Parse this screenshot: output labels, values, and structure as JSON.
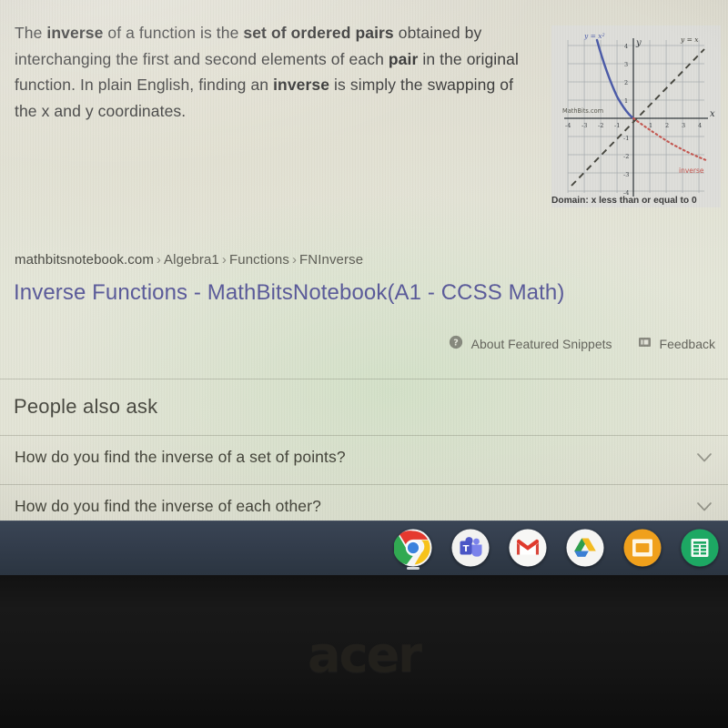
{
  "snippet": {
    "paragraph_runs": [
      {
        "text": "The ",
        "bold": false
      },
      {
        "text": "inverse",
        "bold": true
      },
      {
        "text": " of a function is the ",
        "bold": false
      },
      {
        "text": "set of ordered pairs",
        "bold": true
      },
      {
        "text": " obtained by interchanging the first and second elements of each ",
        "bold": false
      },
      {
        "text": "pair",
        "bold": true
      },
      {
        "text": " in the original function. In plain English, finding an ",
        "bold": false
      },
      {
        "text": "inverse",
        "bold": true
      },
      {
        "text": " is simply the swapping of the x and y coordinates.",
        "bold": false
      }
    ],
    "domain_caption": "Domain:  x less than or equal to 0"
  },
  "figure": {
    "watermark": "MathBits.com",
    "label_parabola": "y = x",
    "label_parabola_exponent": "2",
    "label_identity": "y = x",
    "label_inverse": "inverse",
    "axis_label_x": "x",
    "axis_label_y": "y",
    "x_ticks": [
      "-4",
      "-3",
      "-2",
      "-1",
      "1",
      "2",
      "3",
      "4"
    ],
    "y_ticks": [
      "4",
      "3",
      "2",
      "1",
      "-1",
      "-2",
      "-3",
      "-4"
    ],
    "colors": {
      "parabola": "#4a5aa8",
      "inverse": "#c4564f",
      "identity": "#4a4a42",
      "grid": "#9aa0a8",
      "axis": "#33383c"
    }
  },
  "result": {
    "breadcrumb_host": "mathbitsnotebook.com",
    "breadcrumb_separator": "›",
    "breadcrumb_path": [
      "Algebra1",
      "Functions",
      "FNInverse"
    ],
    "title": "Inverse Functions - MathBitsNotebook(A1 - CCSS Math)",
    "title_color": "#5a5a9a"
  },
  "snippet_footer": {
    "about_label": "About Featured Snippets",
    "about_icon": "question-circle-icon",
    "feedback_label": "Feedback",
    "feedback_icon": "feedback-flag-icon"
  },
  "people_also_ask": {
    "heading": "People also ask",
    "questions": [
      {
        "text": "How do you find the inverse of a set of points?",
        "icon": "chevron-down-icon"
      },
      {
        "text": "How do you find the inverse of each other?",
        "icon": "chevron-down-icon"
      }
    ]
  },
  "shelf": {
    "apps": [
      {
        "name": "chrome",
        "label": "Google Chrome",
        "active": true
      },
      {
        "name": "teams",
        "label": "Microsoft Teams",
        "active": false
      },
      {
        "name": "gmail",
        "label": "Gmail",
        "active": false
      },
      {
        "name": "drive",
        "label": "Google Drive",
        "active": false
      },
      {
        "name": "slides",
        "label": "Google Slides",
        "active": false
      },
      {
        "name": "sheets",
        "label": "Google Sheets",
        "active": false
      }
    ],
    "background_color": "#333d4c"
  },
  "device": {
    "brand_logo": "acer"
  }
}
